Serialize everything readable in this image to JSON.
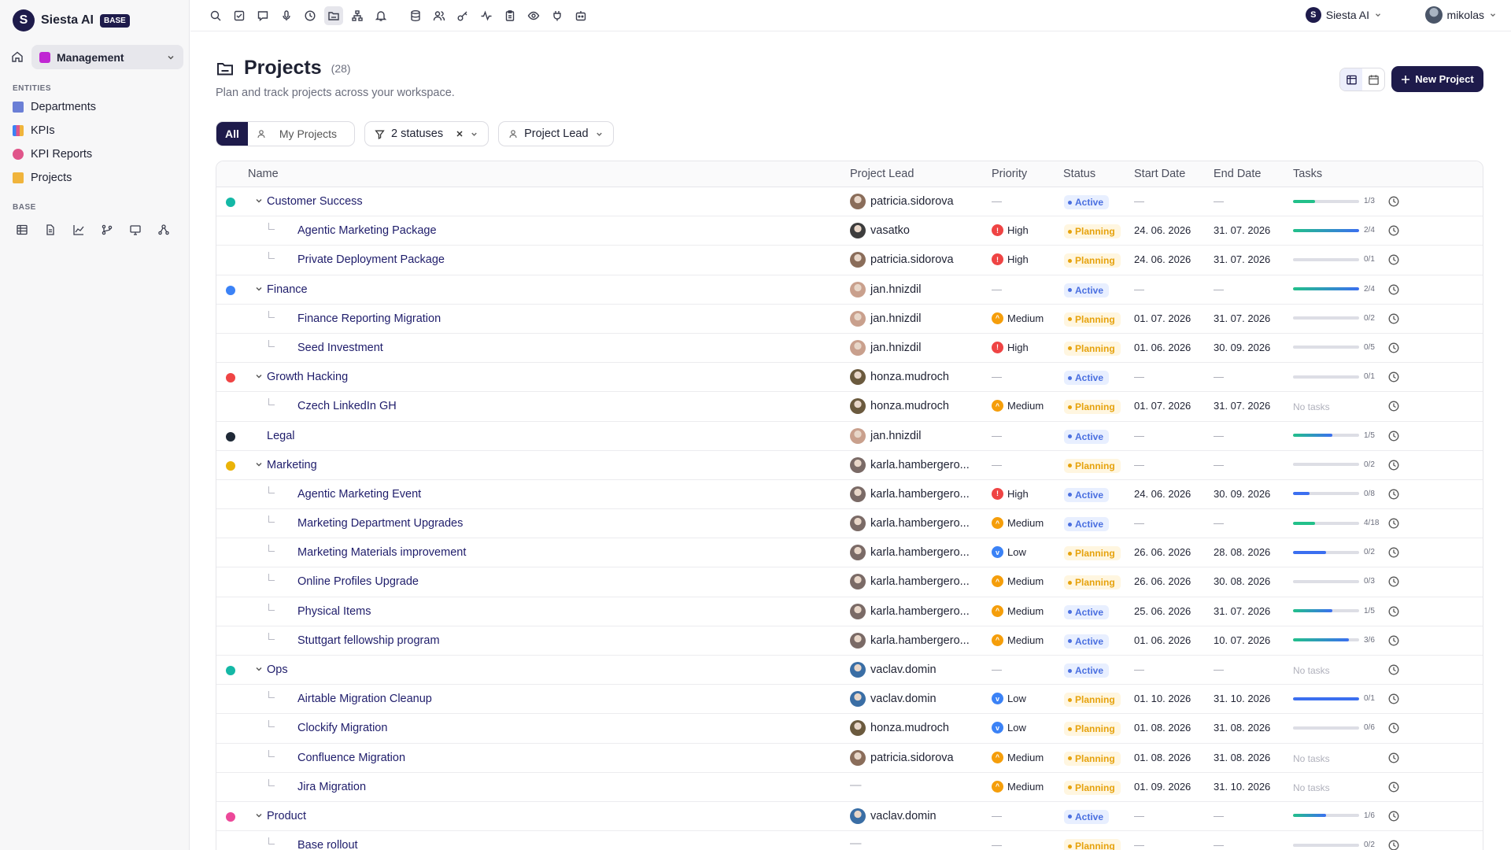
{
  "app": {
    "name": "Siesta AI",
    "badge": "BASE",
    "workspace": "Management"
  },
  "sidebar": {
    "entities_label": "ENTITIES",
    "items": [
      {
        "label": "Departments",
        "color": "#6b7fd6"
      },
      {
        "label": "KPIs",
        "color": "#e0558a"
      },
      {
        "label": "KPI Reports",
        "color": "#e0558a"
      },
      {
        "label": "Projects",
        "color": "#f0b43c"
      }
    ],
    "base_label": "BASE"
  },
  "topbar": {
    "workspace_name": "Siesta AI",
    "user_name": "mikolas"
  },
  "header": {
    "title": "Projects",
    "count": "(28)",
    "subtitle": "Plan and track projects across your workspace.",
    "new_button": "New Project"
  },
  "filters": {
    "all": "All",
    "mine": "My Projects",
    "statuses": "2 statuses",
    "lead": "Project Lead"
  },
  "table": {
    "columns": [
      "Name",
      "Project Lead",
      "Priority",
      "Status",
      "Start Date",
      "End Date",
      "Tasks"
    ],
    "rows": [
      {
        "level": "group",
        "dot": "#14b8a6",
        "name": "Customer Success",
        "lead": "patricia.sidorova",
        "priority": "—",
        "status": "Active",
        "start": "—",
        "end": "—",
        "tasks": "1/3",
        "progress": 0.33,
        "bar": "green"
      },
      {
        "level": "child",
        "name": "Agentic Marketing Package",
        "lead": "vasatko",
        "priority": "High",
        "status": "Planning",
        "start": "24. 06. 2026",
        "end": "31. 07. 2026",
        "tasks": "2/4",
        "progress": 1.0,
        "bar": "mix"
      },
      {
        "level": "child",
        "name": "Private Deployment Package",
        "lead": "patricia.sidorova",
        "priority": "High",
        "status": "Planning",
        "start": "24. 06. 2026",
        "end": "31. 07. 2026",
        "tasks": "0/1",
        "progress": 0,
        "bar": "green"
      },
      {
        "level": "group",
        "dot": "#3b82f6",
        "name": "Finance",
        "lead": "jan.hnizdil",
        "priority": "—",
        "status": "Active",
        "start": "—",
        "end": "—",
        "tasks": "2/4",
        "progress": 1.0,
        "bar": "mix"
      },
      {
        "level": "child",
        "name": "Finance Reporting Migration",
        "lead": "jan.hnizdil",
        "priority": "Medium",
        "status": "Planning",
        "start": "01. 07. 2026",
        "end": "31. 07. 2026",
        "tasks": "0/2",
        "progress": 0,
        "bar": "green"
      },
      {
        "level": "child",
        "name": "Seed Investment",
        "lead": "jan.hnizdil",
        "priority": "High",
        "status": "Planning",
        "start": "01. 06. 2026",
        "end": "30. 09. 2026",
        "tasks": "0/5",
        "progress": 0,
        "bar": "green"
      },
      {
        "level": "group",
        "dot": "#ef4444",
        "name": "Growth Hacking",
        "lead": "honza.mudroch",
        "priority": "—",
        "status": "Active",
        "start": "—",
        "end": "—",
        "tasks": "0/1",
        "progress": 0,
        "bar": "green"
      },
      {
        "level": "child",
        "name": "Czech LinkedIn GH",
        "lead": "honza.mudroch",
        "priority": "Medium",
        "status": "Planning",
        "start": "01. 07. 2026",
        "end": "31. 07. 2026",
        "tasks": "No tasks",
        "progress": null,
        "bar": "green"
      },
      {
        "level": "leaf",
        "dot": "#1f2937",
        "name": "Legal",
        "lead": "jan.hnizdil",
        "priority": "—",
        "status": "Active",
        "start": "—",
        "end": "—",
        "tasks": "1/5",
        "progress": 0.6,
        "bar": "mix"
      },
      {
        "level": "group",
        "dot": "#eab308",
        "name": "Marketing",
        "lead": "karla.hambergero...",
        "priority": "—",
        "status": "Planning",
        "start": "—",
        "end": "—",
        "tasks": "0/2",
        "progress": 0,
        "bar": "green"
      },
      {
        "level": "child",
        "name": "Agentic Marketing Event",
        "lead": "karla.hambergero...",
        "priority": "High",
        "status": "Active",
        "start": "24. 06. 2026",
        "end": "30. 09. 2026",
        "tasks": "0/8",
        "progress": 0.25,
        "bar": "blue"
      },
      {
        "level": "child",
        "name": "Marketing Department Upgrades",
        "lead": "karla.hambergero...",
        "priority": "Medium",
        "status": "Active",
        "start": "—",
        "end": "—",
        "tasks": "4/18",
        "progress": 0.33,
        "bar": "green"
      },
      {
        "level": "child",
        "name": "Marketing Materials improvement",
        "lead": "karla.hambergero...",
        "priority": "Low",
        "status": "Planning",
        "start": "26. 06. 2026",
        "end": "28. 08. 2026",
        "tasks": "0/2",
        "progress": 0.5,
        "bar": "blue"
      },
      {
        "level": "child",
        "name": "Online Profiles Upgrade",
        "lead": "karla.hambergero...",
        "priority": "Medium",
        "status": "Planning",
        "start": "26. 06. 2026",
        "end": "30. 08. 2026",
        "tasks": "0/3",
        "progress": 0,
        "bar": "green"
      },
      {
        "level": "child",
        "name": "Physical Items",
        "lead": "karla.hambergero...",
        "priority": "Medium",
        "status": "Active",
        "start": "25. 06. 2026",
        "end": "31. 07. 2026",
        "tasks": "1/5",
        "progress": 0.6,
        "bar": "mix"
      },
      {
        "level": "child",
        "name": "Stuttgart fellowship program",
        "lead": "karla.hambergero...",
        "priority": "Medium",
        "status": "Active",
        "start": "01. 06. 2026",
        "end": "10. 07. 2026",
        "tasks": "3/6",
        "progress": 0.85,
        "bar": "mix"
      },
      {
        "level": "group",
        "dot": "#14b8a6",
        "name": "Ops",
        "lead": "vaclav.domin",
        "priority": "—",
        "status": "Active",
        "start": "—",
        "end": "—",
        "tasks": "No tasks",
        "progress": null,
        "bar": "green"
      },
      {
        "level": "child",
        "name": "Airtable Migration Cleanup",
        "lead": "vaclav.domin",
        "priority": "Low",
        "status": "Planning",
        "start": "01. 10. 2026",
        "end": "31. 10. 2026",
        "tasks": "0/1",
        "progress": 1.0,
        "bar": "blue"
      },
      {
        "level": "child",
        "name": "Clockify Migration",
        "lead": "honza.mudroch",
        "priority": "Low",
        "status": "Planning",
        "start": "01. 08. 2026",
        "end": "31. 08. 2026",
        "tasks": "0/6",
        "progress": 0,
        "bar": "green"
      },
      {
        "level": "child",
        "name": "Confluence Migration",
        "lead": "patricia.sidorova",
        "priority": "Medium",
        "status": "Planning",
        "start": "01. 08. 2026",
        "end": "31. 08. 2026",
        "tasks": "No tasks",
        "progress": null,
        "bar": "green"
      },
      {
        "level": "child",
        "name": "Jira Migration",
        "lead": "—",
        "priority": "Medium",
        "status": "Planning",
        "start": "01. 09. 2026",
        "end": "31. 10. 2026",
        "tasks": "No tasks",
        "progress": null,
        "bar": "green"
      },
      {
        "level": "group",
        "dot": "#ec4899",
        "name": "Product",
        "lead": "vaclav.domin",
        "priority": "—",
        "status": "Active",
        "start": "—",
        "end": "—",
        "tasks": "1/6",
        "progress": 0.5,
        "bar": "mix"
      },
      {
        "level": "child",
        "name": "Base rollout",
        "lead": "—",
        "priority": "—",
        "status": "Planning",
        "start": "—",
        "end": "—",
        "tasks": "0/2",
        "progress": 0,
        "bar": "green"
      }
    ]
  },
  "colors": {
    "brand": "#1e1b4b",
    "high": "#ef4444",
    "medium": "#f59e0b",
    "low": "#3b82f6"
  }
}
